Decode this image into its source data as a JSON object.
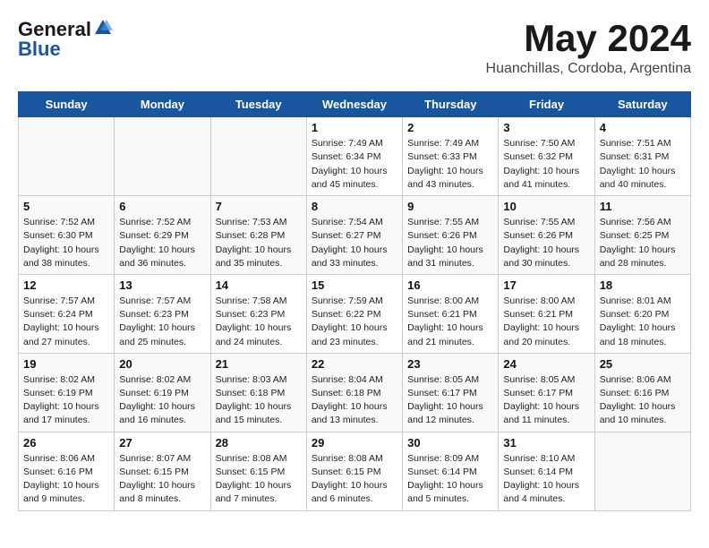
{
  "header": {
    "logo_general": "General",
    "logo_blue": "Blue",
    "month_title": "May 2024",
    "location": "Huanchillas, Cordoba, Argentina"
  },
  "weekdays": [
    "Sunday",
    "Monday",
    "Tuesday",
    "Wednesday",
    "Thursday",
    "Friday",
    "Saturday"
  ],
  "weeks": [
    [
      {
        "day": "",
        "sunrise": "",
        "sunset": "",
        "daylight": ""
      },
      {
        "day": "",
        "sunrise": "",
        "sunset": "",
        "daylight": ""
      },
      {
        "day": "",
        "sunrise": "",
        "sunset": "",
        "daylight": ""
      },
      {
        "day": "1",
        "sunrise": "Sunrise: 7:49 AM",
        "sunset": "Sunset: 6:34 PM",
        "daylight": "Daylight: 10 hours and 45 minutes."
      },
      {
        "day": "2",
        "sunrise": "Sunrise: 7:49 AM",
        "sunset": "Sunset: 6:33 PM",
        "daylight": "Daylight: 10 hours and 43 minutes."
      },
      {
        "day": "3",
        "sunrise": "Sunrise: 7:50 AM",
        "sunset": "Sunset: 6:32 PM",
        "daylight": "Daylight: 10 hours and 41 minutes."
      },
      {
        "day": "4",
        "sunrise": "Sunrise: 7:51 AM",
        "sunset": "Sunset: 6:31 PM",
        "daylight": "Daylight: 10 hours and 40 minutes."
      }
    ],
    [
      {
        "day": "5",
        "sunrise": "Sunrise: 7:52 AM",
        "sunset": "Sunset: 6:30 PM",
        "daylight": "Daylight: 10 hours and 38 minutes."
      },
      {
        "day": "6",
        "sunrise": "Sunrise: 7:52 AM",
        "sunset": "Sunset: 6:29 PM",
        "daylight": "Daylight: 10 hours and 36 minutes."
      },
      {
        "day": "7",
        "sunrise": "Sunrise: 7:53 AM",
        "sunset": "Sunset: 6:28 PM",
        "daylight": "Daylight: 10 hours and 35 minutes."
      },
      {
        "day": "8",
        "sunrise": "Sunrise: 7:54 AM",
        "sunset": "Sunset: 6:27 PM",
        "daylight": "Daylight: 10 hours and 33 minutes."
      },
      {
        "day": "9",
        "sunrise": "Sunrise: 7:55 AM",
        "sunset": "Sunset: 6:26 PM",
        "daylight": "Daylight: 10 hours and 31 minutes."
      },
      {
        "day": "10",
        "sunrise": "Sunrise: 7:55 AM",
        "sunset": "Sunset: 6:26 PM",
        "daylight": "Daylight: 10 hours and 30 minutes."
      },
      {
        "day": "11",
        "sunrise": "Sunrise: 7:56 AM",
        "sunset": "Sunset: 6:25 PM",
        "daylight": "Daylight: 10 hours and 28 minutes."
      }
    ],
    [
      {
        "day": "12",
        "sunrise": "Sunrise: 7:57 AM",
        "sunset": "Sunset: 6:24 PM",
        "daylight": "Daylight: 10 hours and 27 minutes."
      },
      {
        "day": "13",
        "sunrise": "Sunrise: 7:57 AM",
        "sunset": "Sunset: 6:23 PM",
        "daylight": "Daylight: 10 hours and 25 minutes."
      },
      {
        "day": "14",
        "sunrise": "Sunrise: 7:58 AM",
        "sunset": "Sunset: 6:23 PM",
        "daylight": "Daylight: 10 hours and 24 minutes."
      },
      {
        "day": "15",
        "sunrise": "Sunrise: 7:59 AM",
        "sunset": "Sunset: 6:22 PM",
        "daylight": "Daylight: 10 hours and 23 minutes."
      },
      {
        "day": "16",
        "sunrise": "Sunrise: 8:00 AM",
        "sunset": "Sunset: 6:21 PM",
        "daylight": "Daylight: 10 hours and 21 minutes."
      },
      {
        "day": "17",
        "sunrise": "Sunrise: 8:00 AM",
        "sunset": "Sunset: 6:21 PM",
        "daylight": "Daylight: 10 hours and 20 minutes."
      },
      {
        "day": "18",
        "sunrise": "Sunrise: 8:01 AM",
        "sunset": "Sunset: 6:20 PM",
        "daylight": "Daylight: 10 hours and 18 minutes."
      }
    ],
    [
      {
        "day": "19",
        "sunrise": "Sunrise: 8:02 AM",
        "sunset": "Sunset: 6:19 PM",
        "daylight": "Daylight: 10 hours and 17 minutes."
      },
      {
        "day": "20",
        "sunrise": "Sunrise: 8:02 AM",
        "sunset": "Sunset: 6:19 PM",
        "daylight": "Daylight: 10 hours and 16 minutes."
      },
      {
        "day": "21",
        "sunrise": "Sunrise: 8:03 AM",
        "sunset": "Sunset: 6:18 PM",
        "daylight": "Daylight: 10 hours and 15 minutes."
      },
      {
        "day": "22",
        "sunrise": "Sunrise: 8:04 AM",
        "sunset": "Sunset: 6:18 PM",
        "daylight": "Daylight: 10 hours and 13 minutes."
      },
      {
        "day": "23",
        "sunrise": "Sunrise: 8:05 AM",
        "sunset": "Sunset: 6:17 PM",
        "daylight": "Daylight: 10 hours and 12 minutes."
      },
      {
        "day": "24",
        "sunrise": "Sunrise: 8:05 AM",
        "sunset": "Sunset: 6:17 PM",
        "daylight": "Daylight: 10 hours and 11 minutes."
      },
      {
        "day": "25",
        "sunrise": "Sunrise: 8:06 AM",
        "sunset": "Sunset: 6:16 PM",
        "daylight": "Daylight: 10 hours and 10 minutes."
      }
    ],
    [
      {
        "day": "26",
        "sunrise": "Sunrise: 8:06 AM",
        "sunset": "Sunset: 6:16 PM",
        "daylight": "Daylight: 10 hours and 9 minutes."
      },
      {
        "day": "27",
        "sunrise": "Sunrise: 8:07 AM",
        "sunset": "Sunset: 6:15 PM",
        "daylight": "Daylight: 10 hours and 8 minutes."
      },
      {
        "day": "28",
        "sunrise": "Sunrise: 8:08 AM",
        "sunset": "Sunset: 6:15 PM",
        "daylight": "Daylight: 10 hours and 7 minutes."
      },
      {
        "day": "29",
        "sunrise": "Sunrise: 8:08 AM",
        "sunset": "Sunset: 6:15 PM",
        "daylight": "Daylight: 10 hours and 6 minutes."
      },
      {
        "day": "30",
        "sunrise": "Sunrise: 8:09 AM",
        "sunset": "Sunset: 6:14 PM",
        "daylight": "Daylight: 10 hours and 5 minutes."
      },
      {
        "day": "31",
        "sunrise": "Sunrise: 8:10 AM",
        "sunset": "Sunset: 6:14 PM",
        "daylight": "Daylight: 10 hours and 4 minutes."
      },
      {
        "day": "",
        "sunrise": "",
        "sunset": "",
        "daylight": ""
      }
    ]
  ]
}
